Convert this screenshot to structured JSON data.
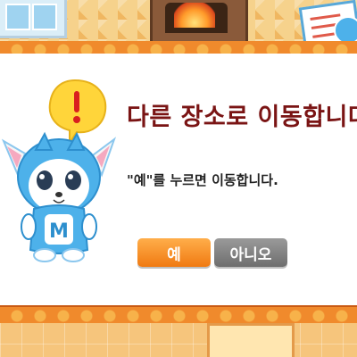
{
  "dialog": {
    "title": "다른 장소로 이동합니다.",
    "message": "\"예\"를 누르면 이동합니다.",
    "yes_label": "예",
    "no_label": "아니오"
  },
  "colors": {
    "title": "#7a1414",
    "band": "#f08a2c",
    "yes_button": "#f07a12",
    "no_button": "#6e6e6e",
    "mascot_hood": "#4db1ea"
  },
  "icons": {
    "speech_bubble": "exclamation-speech-bubble-icon",
    "mascot": "blue-hooded-cat-mascot"
  }
}
